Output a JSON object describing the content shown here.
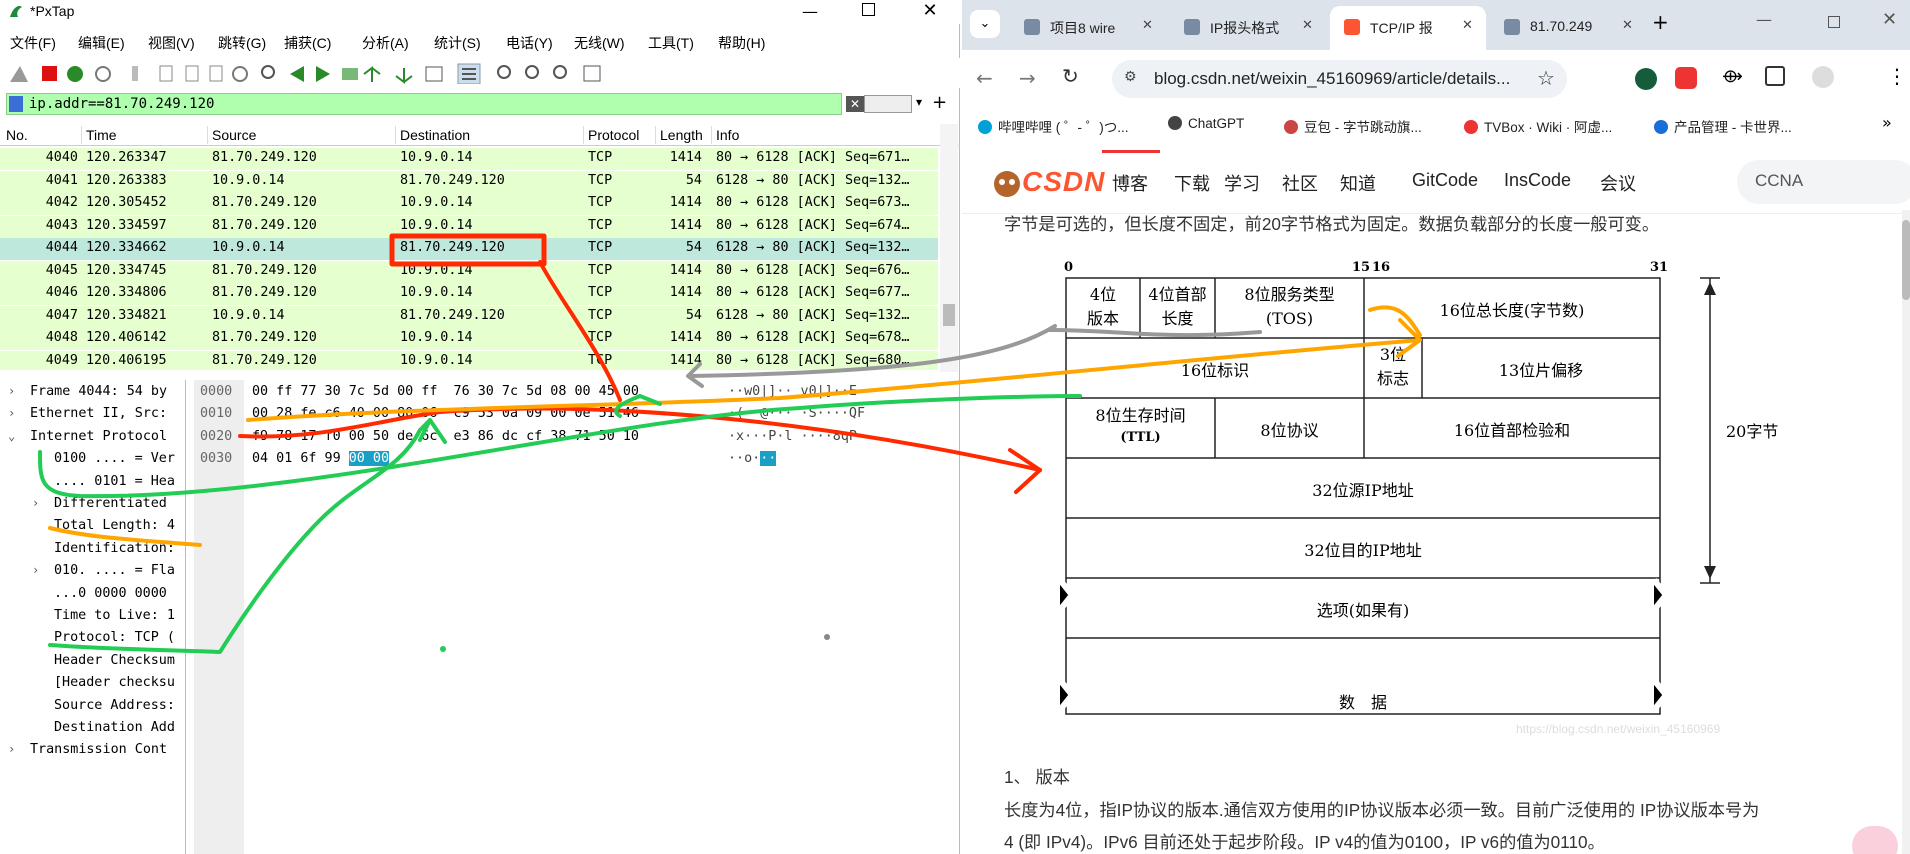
{
  "ws": {
    "title": "*PxTap",
    "menus": [
      "文件(F)",
      "编辑(E)",
      "视图(V)",
      "跳转(G)",
      "捕获(C)",
      "分析(A)",
      "统计(S)",
      "电话(Y)",
      "无线(W)",
      "工具(T)",
      "帮助(H)"
    ],
    "filter": "ip.addr==81.70.249.120",
    "columns": [
      "No.",
      "Time",
      "Source",
      "Destination",
      "Protocol",
      "Length",
      "Info"
    ],
    "packets": [
      {
        "no": "4040",
        "time": "120.263347",
        "src": "81.70.249.120",
        "dst": "10.9.0.14",
        "proto": "TCP",
        "len": "1414",
        "info": "80 → 6128 [ACK] Seq=671…"
      },
      {
        "no": "4041",
        "time": "120.263383",
        "src": "10.9.0.14",
        "dst": "81.70.249.120",
        "proto": "TCP",
        "len": "54",
        "info": "6128 → 80 [ACK] Seq=132…"
      },
      {
        "no": "4042",
        "time": "120.305452",
        "src": "81.70.249.120",
        "dst": "10.9.0.14",
        "proto": "TCP",
        "len": "1414",
        "info": "80 → 6128 [ACK] Seq=673…"
      },
      {
        "no": "4043",
        "time": "120.334597",
        "src": "81.70.249.120",
        "dst": "10.9.0.14",
        "proto": "TCP",
        "len": "1414",
        "info": "80 → 6128 [ACK] Seq=674…"
      },
      {
        "no": "4044",
        "time": "120.334662",
        "src": "10.9.0.14",
        "dst": "81.70.249.120",
        "proto": "TCP",
        "len": "54",
        "info": "6128 → 80 [ACK] Seq=132…"
      },
      {
        "no": "4045",
        "time": "120.334745",
        "src": "81.70.249.120",
        "dst": "10.9.0.14",
        "proto": "TCP",
        "len": "1414",
        "info": "80 → 6128 [ACK] Seq=676…"
      },
      {
        "no": "4046",
        "time": "120.334806",
        "src": "81.70.249.120",
        "dst": "10.9.0.14",
        "proto": "TCP",
        "len": "1414",
        "info": "80 → 6128 [ACK] Seq=677…"
      },
      {
        "no": "4047",
        "time": "120.334821",
        "src": "10.9.0.14",
        "dst": "81.70.249.120",
        "proto": "TCP",
        "len": "54",
        "info": "6128 → 80 [ACK] Seq=132…"
      },
      {
        "no": "4048",
        "time": "120.406142",
        "src": "81.70.249.120",
        "dst": "10.9.0.14",
        "proto": "TCP",
        "len": "1414",
        "info": "80 → 6128 [ACK] Seq=678…"
      },
      {
        "no": "4049",
        "time": "120.406195",
        "src": "81.70.249.120",
        "dst": "10.9.0.14",
        "proto": "TCP",
        "len": "1414",
        "info": "80 → 6128 [ACK] Seq=680…"
      }
    ],
    "tree": [
      {
        "arrow": ">",
        "text": "Frame 4044: 54 by"
      },
      {
        "arrow": ">",
        "text": "Ethernet II, Src:"
      },
      {
        "arrow": "v",
        "text": "Internet Protocol"
      },
      {
        "arrow": "",
        "text": "0100 .... = Ver"
      },
      {
        "arrow": "",
        "text": ".... 0101 = Hea"
      },
      {
        "arrow": ">",
        "text": "Differentiated"
      },
      {
        "arrow": "",
        "text": "Total Length: 4"
      },
      {
        "arrow": "",
        "text": "Identification:"
      },
      {
        "arrow": ">",
        "text": "010. .... = Fla"
      },
      {
        "arrow": "",
        "text": "...0 0000 0000"
      },
      {
        "arrow": "",
        "text": "Time to Live: 1"
      },
      {
        "arrow": "",
        "text": "Protocol: TCP ("
      },
      {
        "arrow": "",
        "text": "Header Checksum"
      },
      {
        "arrow": "",
        "text": "[Header checksu"
      },
      {
        "arrow": "",
        "text": "Source Address:"
      },
      {
        "arrow": "",
        "text": "Destination Add"
      },
      {
        "arrow": ">",
        "text": "Transmission Cont"
      }
    ],
    "hex": [
      {
        "off": "0000",
        "bytes": "00 ff 77 30 7c 5d 00 ff  76 30 7c 5d 08 00 45 00",
        "ascii": "··w0|]·· v0|]··E·"
      },
      {
        "off": "0010",
        "bytes": "00 28 fe c6 40 00 80 06  c9 53 0a 09 00 0e 51 46",
        "ascii": "·(··@··· ·S····QF"
      },
      {
        "off": "0020",
        "bytes": "f9 78 17 f0 00 50 de 6c  e3 86 dc cf 38 71 50 10",
        "ascii": "·x···P·l ····8qP·"
      },
      {
        "off": "0030",
        "bytes": "04 01 6f 99",
        "sel": "00 00",
        "ascii": "··o·",
        "asel": "··"
      }
    ]
  },
  "br": {
    "tabs": [
      "项目8 wire",
      "IP报头格式",
      "TCP/IP 报",
      "81.70.249"
    ],
    "url": "blog.csdn.net/weixin_45160969/article/details...",
    "bookmarks": [
      "哔哩哔哩 ( ゜- ゜)つ...",
      "ChatGPT",
      "豆包 - 字节跳动旗...",
      "TVBox · Wiki · 阿虚...",
      "产品管理 - 卡世界..."
    ],
    "logo": "CSDN",
    "nav": [
      "博客",
      "下载",
      "学习",
      "社区",
      "知道",
      "GitCode",
      "InsCode",
      "会议"
    ],
    "search_placeholder": "CCNA",
    "intro": "字节是可选的，但长度不固定，前20字节格式为固定。数据负载部分的长度一般可变。",
    "ticks": [
      "0",
      "15",
      "16",
      "31"
    ],
    "f_version": [
      "4位",
      "版本"
    ],
    "f_ihl": [
      "4位首部",
      "长度"
    ],
    "f_tos": [
      "8位服务类型",
      "(TOS)"
    ],
    "f_total": "16位总长度(字节数)",
    "f_id": "16位标识",
    "f_flags": [
      "3位",
      "标志"
    ],
    "f_frag": "13位片偏移",
    "f_ttl": [
      "8位生存时间",
      "(TTL)"
    ],
    "f_proto": "8位协议",
    "f_cksum": "16位首部检验和",
    "f_src": "32位源IP地址",
    "f_dst": "32位目的IP地址",
    "f_opt": "选项(如果有)",
    "f_data": "数　据",
    "bytes20": "20字节",
    "watermark": "https://blog.csdn.net/weixin_45160969",
    "h_version": "1、 版本",
    "p1": "长度为4位，指IP协议的版本.通信双方使用的IP协议版本必须一致。目前广泛使用的 IP协议版本号为",
    "p2": "4 (即 IPv4)。IPv6 目前还处于起步阶段。IP v4的值为0100，IP v6的值为0110。"
  }
}
